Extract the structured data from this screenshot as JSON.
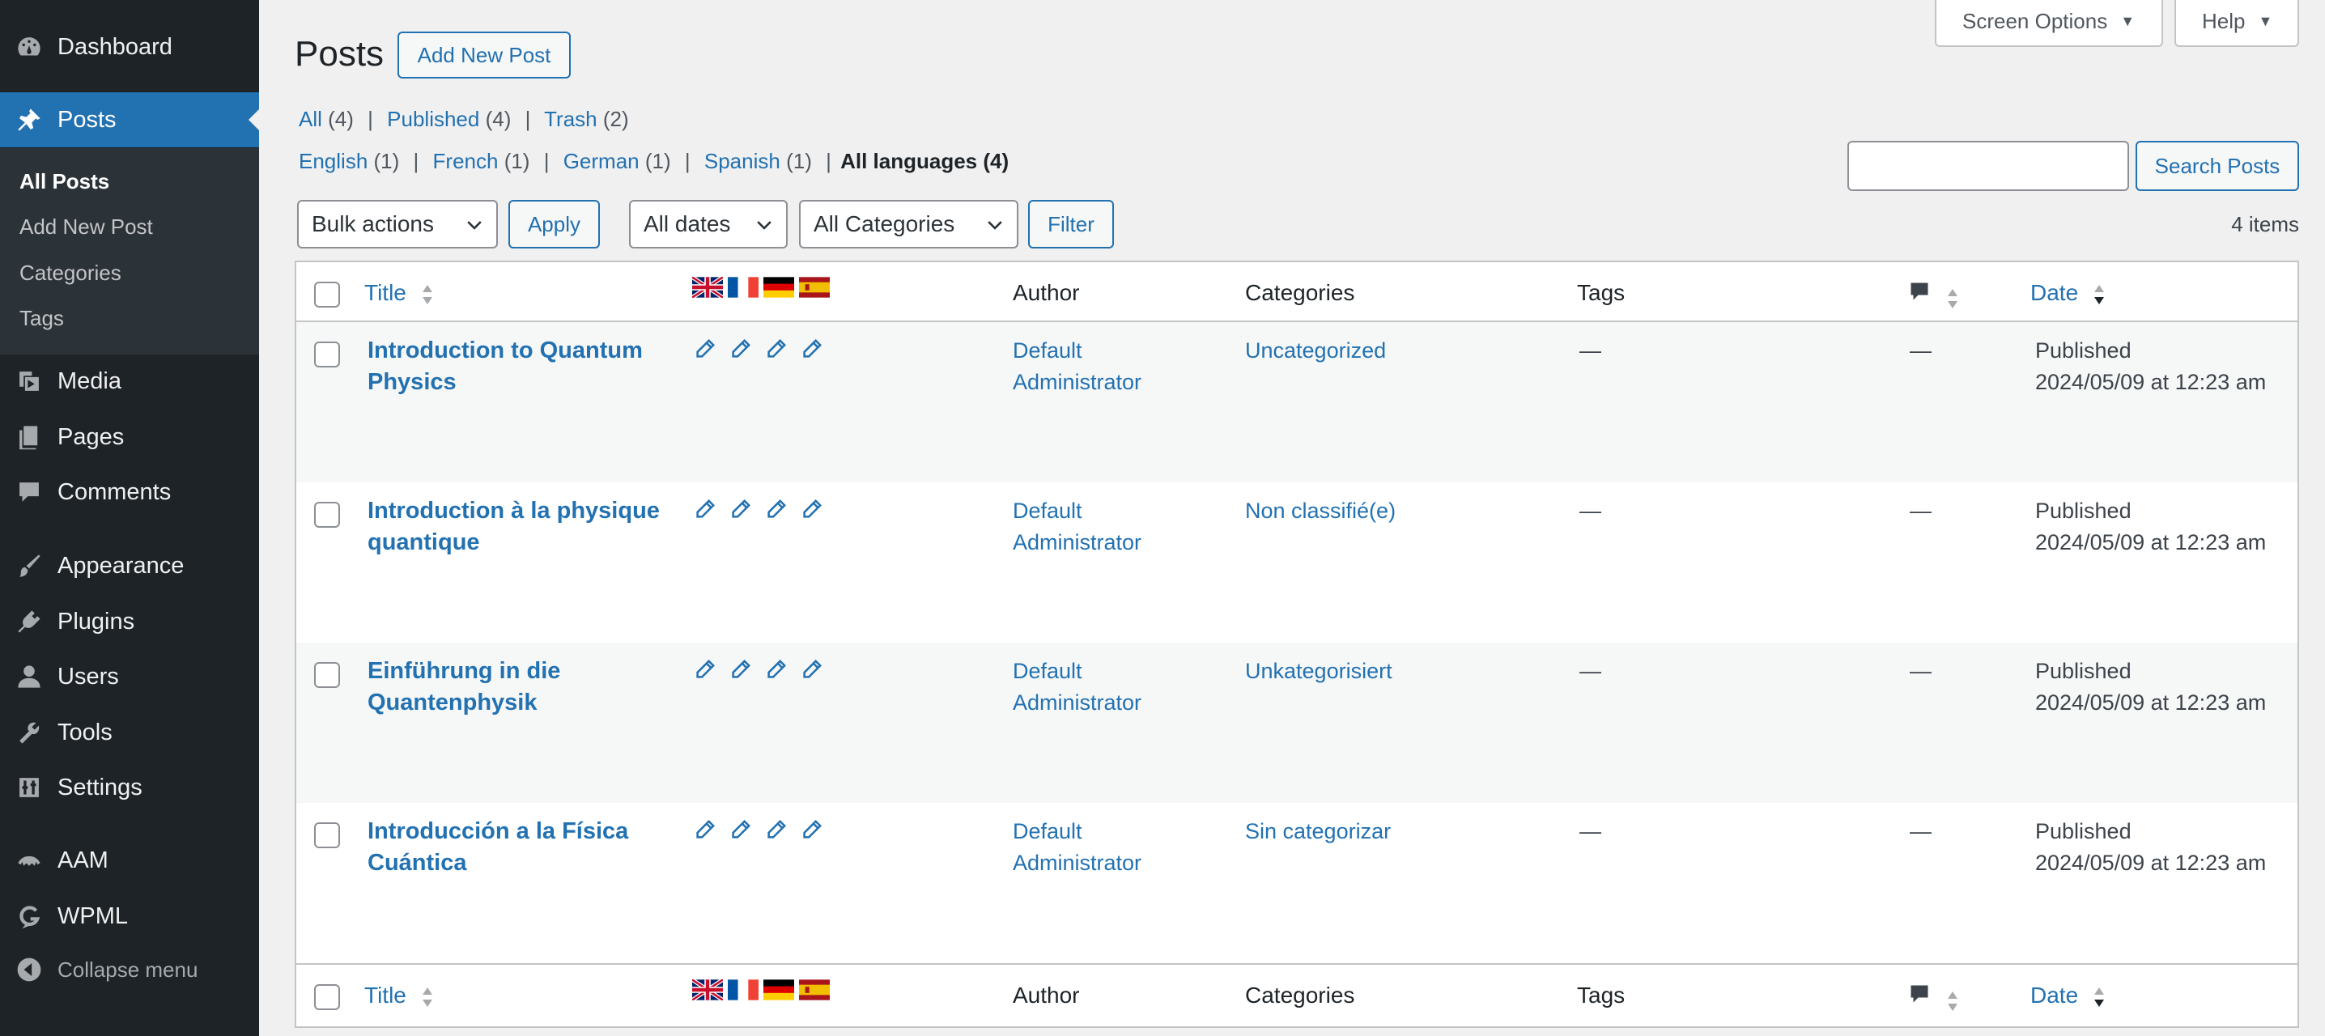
{
  "sidebar": {
    "items": [
      {
        "key": "dashboard",
        "label": "Dashboard",
        "icon": "dashboard-icon"
      },
      {
        "key": "posts",
        "label": "Posts",
        "icon": "pin-icon"
      },
      {
        "key": "media",
        "label": "Media",
        "icon": "media-icon"
      },
      {
        "key": "pages",
        "label": "Pages",
        "icon": "page-icon"
      },
      {
        "key": "comments",
        "label": "Comments",
        "icon": "comment-icon"
      },
      {
        "key": "appearance",
        "label": "Appearance",
        "icon": "brush-icon"
      },
      {
        "key": "plugins",
        "label": "Plugins",
        "icon": "plug-icon"
      },
      {
        "key": "users",
        "label": "Users",
        "icon": "user-icon"
      },
      {
        "key": "tools",
        "label": "Tools",
        "icon": "wrench-icon"
      },
      {
        "key": "settings",
        "label": "Settings",
        "icon": "settings-icon"
      },
      {
        "key": "aam",
        "label": "AAM",
        "icon": "aam-icon"
      },
      {
        "key": "wpml",
        "label": "WPML",
        "icon": "wpml-icon"
      }
    ],
    "submenu": [
      "All Posts",
      "Add New Post",
      "Categories",
      "Tags"
    ],
    "collapse_label": "Collapse menu",
    "accent": "#2271b1",
    "background": "#1d2327"
  },
  "top": {
    "screen_options": "Screen Options",
    "help": "Help"
  },
  "header": {
    "title": "Posts",
    "add_new": "Add New Post"
  },
  "status_filter": {
    "all": {
      "label": "All",
      "count": "(4)"
    },
    "published": {
      "label": "Published",
      "count": "(4)"
    },
    "trash": {
      "label": "Trash",
      "count": "(2)"
    }
  },
  "languages": {
    "english": {
      "label": "English",
      "count": "(1)"
    },
    "french": {
      "label": "French",
      "count": "(1)"
    },
    "german": {
      "label": "German",
      "count": "(1)"
    },
    "spanish": {
      "label": "Spanish",
      "count": "(1)"
    },
    "all": "All languages (4)"
  },
  "search": {
    "button": "Search Posts",
    "value": ""
  },
  "filters": {
    "bulk_actions": "Bulk actions",
    "apply": "Apply",
    "dates": "All dates",
    "categories": "All Categories",
    "filter": "Filter",
    "items_count": "4 items"
  },
  "table": {
    "columns": {
      "title": "Title",
      "author": "Author",
      "categories": "Categories",
      "tags": "Tags",
      "date": "Date"
    },
    "flag_icons": [
      "flag-uk-icon",
      "flag-fr-icon",
      "flag-de-icon",
      "flag-es-icon"
    ],
    "rows": [
      {
        "title_line1": "Introduction to Quantum",
        "title_line2": "Physics",
        "author_line1": "Default",
        "author_line2": "Administrator",
        "category": "Uncategorized",
        "tags": "—",
        "comments": "—",
        "status": "Published",
        "date": "2024/05/09 at 12:23 am"
      },
      {
        "title_line1": "Introduction à la physique",
        "title_line2": "quantique",
        "author_line1": "Default",
        "author_line2": "Administrator",
        "category": "Non classifié(e)",
        "tags": "—",
        "comments": "—",
        "status": "Published",
        "date": "2024/05/09 at 12:23 am"
      },
      {
        "title_line1": "Einführung in die",
        "title_line2": "Quantenphysik",
        "author_line1": "Default",
        "author_line2": "Administrator",
        "category": "Unkategorisiert",
        "tags": "—",
        "comments": "—",
        "status": "Published",
        "date": "2024/05/09 at 12:23 am"
      },
      {
        "title_line1": "Introducción a la Física",
        "title_line2": "Cuántica",
        "author_line1": "Default",
        "author_line2": "Administrator",
        "category": "Sin categorizar",
        "tags": "—",
        "comments": "—",
        "status": "Published",
        "date": "2024/05/09 at 12:23 am"
      }
    ]
  }
}
